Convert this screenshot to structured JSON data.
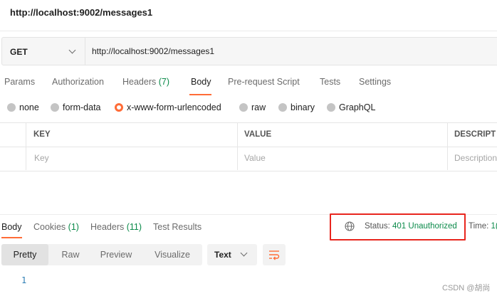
{
  "request": {
    "title": "http://localhost:9002/messages1",
    "method": "GET",
    "url": "http://localhost:9002/messages1"
  },
  "request_tabs": [
    {
      "label": "Params"
    },
    {
      "label": "Authorization"
    },
    {
      "label": "Headers",
      "count": "(7)"
    },
    {
      "label": "Body"
    },
    {
      "label": "Pre-request Script"
    },
    {
      "label": "Tests"
    },
    {
      "label": "Settings"
    }
  ],
  "body_types": [
    {
      "label": "none"
    },
    {
      "label": "form-data"
    },
    {
      "label": "x-www-form-urlencoded",
      "selected": true
    },
    {
      "label": "raw"
    },
    {
      "label": "binary"
    },
    {
      "label": "GraphQL"
    }
  ],
  "kv_table": {
    "headers": [
      "KEY",
      "VALUE",
      "DESCRIPT"
    ],
    "placeholders": [
      "Key",
      "Value",
      "Description"
    ]
  },
  "response_tabs": [
    {
      "label": "Body"
    },
    {
      "label": "Cookies",
      "count": "(1)"
    },
    {
      "label": "Headers",
      "count": "(11)"
    },
    {
      "label": "Test Results"
    }
  ],
  "response_status": {
    "label": "Status:",
    "value": "401 Unauthorized",
    "time_label": "Time:",
    "time_value": "1("
  },
  "view_modes": [
    "Pretty",
    "Raw",
    "Preview",
    "Visualize"
  ],
  "format": "Text",
  "code": {
    "line_number": "1"
  },
  "watermark": "CSDN @胡尚",
  "colors": {
    "accent": "#ff6c37",
    "success": "#0b8a4a",
    "highlight_box": "#e8261e"
  }
}
